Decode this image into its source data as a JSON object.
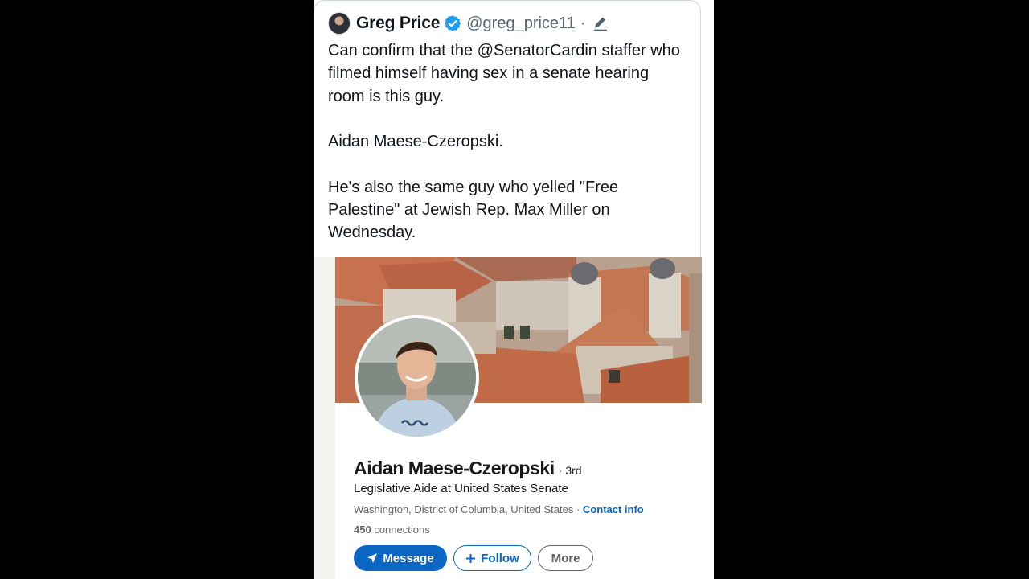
{
  "tweet": {
    "author_name": "Greg Price",
    "handle": "@greg_price11",
    "separator": "·",
    "paragraphs": [
      "Can confirm that the @SenatorCardin staffer who filmed himself having sex in a senate hearing room is this guy.",
      "Aidan Maese-Czeropski.",
      "He's also the same guy who yelled \"Free Palestine\" at Jewish Rep. Max Miller on Wednesday."
    ],
    "icons": {
      "avatar": "user-avatar",
      "verified": "verified-badge-icon",
      "edited": "pencil-icon"
    }
  },
  "linkedin_profile": {
    "name": "Aidan Maese-Czeropski",
    "degree": "· 3rd",
    "headline": "Legislative Aide at United States Senate",
    "location": "Washington, District of Columbia, United States · ",
    "contact_info": "Contact info",
    "connections_count": "450",
    "connections_label": " connections",
    "buttons": {
      "message": "Message",
      "follow": "Follow",
      "more": "More"
    },
    "icons": {
      "message": "send-icon",
      "follow": "plus-icon"
    }
  },
  "colors": {
    "linkedin_blue": "#0a66c2",
    "twitter_blue": "#1d9bf0",
    "text_primary": "#0f1419",
    "text_secondary": "#536471",
    "background": "#000000"
  }
}
